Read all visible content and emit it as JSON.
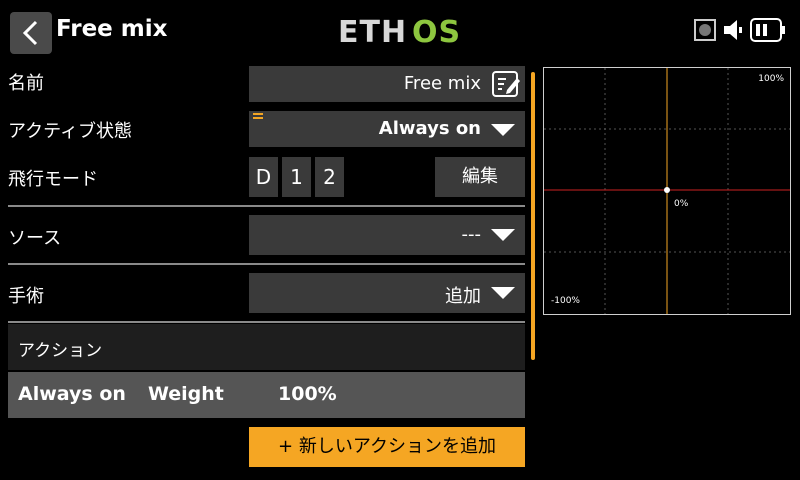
{
  "header": {
    "title": "Free mix",
    "logo": "ETHOS",
    "icons": [
      "back-chevron-icon",
      "record-indicator-icon",
      "speaker-icon",
      "battery-icon"
    ]
  },
  "form": {
    "name_label": "名前",
    "name_value": "Free mix",
    "active_label": "アクティブ状態",
    "active_value": "Always on",
    "flight_mode_label": "飛行モード",
    "flight_modes": [
      "D",
      "1",
      "2"
    ],
    "edit_button": "編集",
    "source_label": "ソース",
    "source_value": "---",
    "operation_label": "手術",
    "operation_value": "追加"
  },
  "actions": {
    "header": "アクション",
    "row": {
      "trigger": "Always on",
      "type": "Weight",
      "value": "100%"
    },
    "add_button": "+ 新しいアクションを追加"
  },
  "graph": {
    "max_label": "100%",
    "min_label": "-100%",
    "center_label": "0%",
    "colors": {
      "vertical_line": "#f5a623",
      "horizontal_line": "#cc2222",
      "accent": "#f5a623"
    }
  }
}
